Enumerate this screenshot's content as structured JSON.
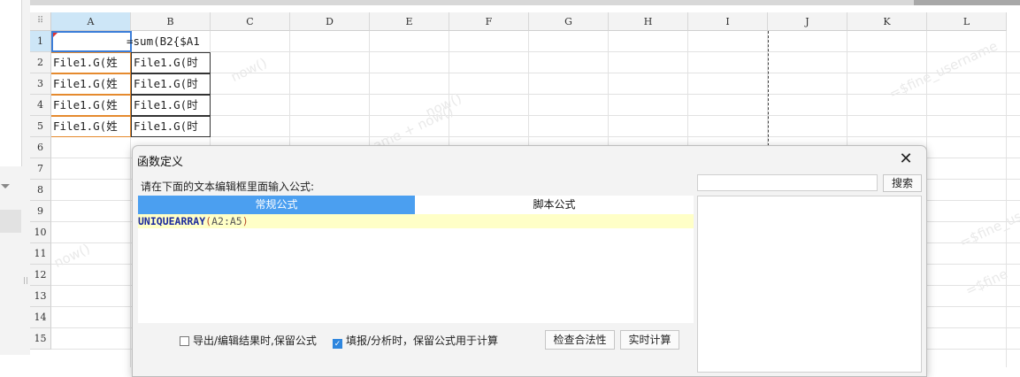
{
  "columns": [
    "A",
    "B",
    "C",
    "D",
    "E",
    "F",
    "G",
    "H",
    "I",
    "J",
    "K",
    "L"
  ],
  "rows": [
    "1",
    "2",
    "3",
    "4",
    "5",
    "6",
    "7",
    "8",
    "9",
    "10",
    "11",
    "12",
    "13",
    "14",
    "15"
  ],
  "corner_glyph": "⠿",
  "cells": {
    "b1": "=sum(B2{$A1",
    "a_rows": [
      "File1.G(姓",
      "File1.G(姓",
      "File1.G(姓",
      "File1.G(姓"
    ],
    "b_rows": [
      "File1.G(时",
      "File1.G(时",
      "File1.G(时",
      "File1.G(时"
    ]
  },
  "watermarks": [
    "now()",
    "=$fine_username",
    "now()",
    "=$fine_usernam",
    "$name + now()",
    "now()",
    "=$fine"
  ],
  "dialog": {
    "title": "函数定义",
    "close_glyph": "✕",
    "prompt": "请在下面的文本编辑框里面输入公式:",
    "tab_regular": "常规公式",
    "tab_script": "脚本公式",
    "formula_fn": "UNIQUEARRAY",
    "formula_open": "(",
    "formula_arg": "A2:A5",
    "formula_close": ")",
    "search_button": "搜索",
    "check_export": "导出/编辑结果时,保留公式",
    "check_export_checked": false,
    "check_fill": "填报/分析时，保留公式用于计算",
    "check_fill_checked": true,
    "check_mark": "✓",
    "btn_validate": "检查合法性",
    "btn_realtime": "实时计算"
  }
}
